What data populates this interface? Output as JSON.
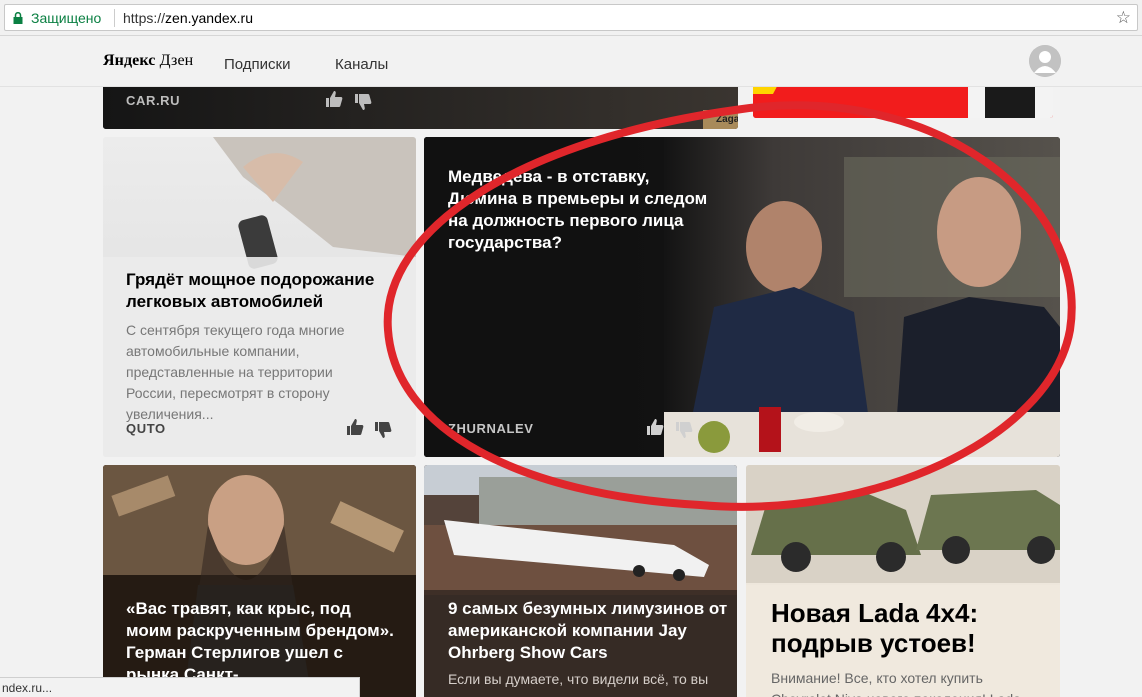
{
  "browser": {
    "secure_label": "Защищено",
    "url_scheme": "https://",
    "url_host": "zen.yandex.ru",
    "status_url": "ndex.ru..."
  },
  "header": {
    "logo_bold": "Яндекс",
    "logo_light": "Дзен",
    "nav": [
      "Подписки",
      "Каналы"
    ]
  },
  "cards": {
    "car": {
      "source": "CAR.RU",
      "watermark": "Zaga"
    },
    "quto": {
      "title": "Грядёт мощное подорожание легковых автомобилей",
      "text": "С сентября текущего года многие автомобильные компании, представленные на территории России, пересмотрят в сторону увеличения...",
      "source": "QUTO"
    },
    "zhur": {
      "title": "Медведева - в отставку, Дюмина в премьеры и следом на должность первого лица государства?",
      "source": "ZHURNALEV"
    },
    "sterl": {
      "title": "«Вас травят, как крыс, под моим раскрученным брендом». Герман Стерлигов ушел с рынка Санкт-"
    },
    "limo": {
      "title": "9 самых безумных лимузинов от американской компании Jay Ohrberg Show Cars",
      "text": "Если вы думаете, что видели всё, то вы"
    },
    "lada": {
      "title": "Новая Lada 4x4: подрыв устоев!",
      "text": "Внимание! Все, кто хотел купить Chevrolet Niva нового поколения! Lada"
    }
  },
  "colors": {
    "secure_green": "#0b8043",
    "annotation_red": "#e0262b"
  }
}
